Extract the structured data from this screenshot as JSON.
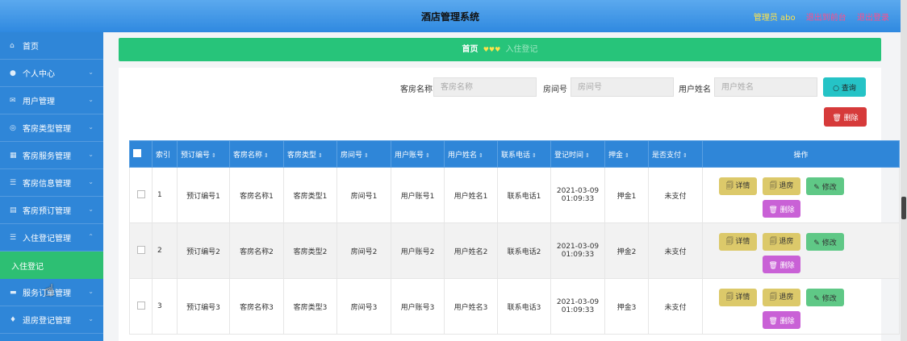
{
  "header": {
    "title": "酒店管理系统",
    "admin_label": "管理员 abo",
    "front_link": "退出到前台",
    "logout_link": "退出登录"
  },
  "sidebar": {
    "items": [
      {
        "label": "首页",
        "icon": "home-icon"
      },
      {
        "label": "个人中心",
        "icon": "user-icon"
      },
      {
        "label": "用户管理",
        "icon": "mail-icon"
      },
      {
        "label": "客房类型管理",
        "icon": "circle-icon"
      },
      {
        "label": "客房服务管理",
        "icon": "grid-icon"
      },
      {
        "label": "客房信息管理",
        "icon": "list-icon"
      },
      {
        "label": "客房预订管理",
        "icon": "calendar-icon"
      },
      {
        "label": "入住登记管理",
        "icon": "list-icon"
      },
      {
        "label": "入住登记",
        "icon": ""
      },
      {
        "label": "服务订单管理",
        "icon": "card-icon"
      },
      {
        "label": "退房登记管理",
        "icon": "pin-icon"
      }
    ]
  },
  "breadcrumb": {
    "home": "首页",
    "separator": "♥♥♥",
    "current": "入住登记"
  },
  "search": {
    "room_name_label": "客房名称",
    "room_name_placeholder": "客房名称",
    "room_no_label": "房间号",
    "room_no_placeholder": "房间号",
    "user_name_label": "用户姓名",
    "user_name_placeholder": "用户姓名",
    "search_button": "○ 查询",
    "delete_button": "🗑 删除"
  },
  "table": {
    "columns": [
      "索引",
      "预订编号",
      "客房名称",
      "客房类型",
      "房间号",
      "用户账号",
      "用户姓名",
      "联系电话",
      "登记时间",
      "押金",
      "是否支付",
      "操作"
    ],
    "sort_icon": "⇕",
    "rows": [
      {
        "index": "1",
        "booking": "预订编号1",
        "room_name": "客房名称1",
        "room_type": "客房类型1",
        "room_no": "房间号1",
        "account": "用户账号1",
        "user": "用户姓名1",
        "phone": "联系电话1",
        "date": "2021-03-09",
        "time": "01:09:33",
        "deposit": "押金1",
        "paid": "未支付"
      },
      {
        "index": "2",
        "booking": "预订编号2",
        "room_name": "客房名称2",
        "room_type": "客房类型2",
        "room_no": "房间号2",
        "account": "用户账号2",
        "user": "用户姓名2",
        "phone": "联系电话2",
        "date": "2021-03-09",
        "time": "01:09:33",
        "deposit": "押金2",
        "paid": "未支付"
      },
      {
        "index": "3",
        "booking": "预订编号3",
        "room_name": "客房名称3",
        "room_type": "客房类型3",
        "room_no": "房间号3",
        "account": "用户账号3",
        "user": "用户姓名3",
        "phone": "联系电话3",
        "date": "2021-03-09",
        "time": "01:09:33",
        "deposit": "押金3",
        "paid": "未支付"
      }
    ],
    "actions": {
      "detail": "🗐 详情",
      "checkout": "🗐 退房",
      "edit": "✎ 修改",
      "delete": "🗑 删除"
    }
  },
  "colors": {
    "header_blue": "#2f89e0",
    "sidebar_blue": "#2f86d8",
    "accent_green": "#27c47a",
    "search_teal": "#25c3c6",
    "danger_red": "#d63a3a",
    "detail_yellow": "#dcc96a",
    "edit_green": "#5fc886",
    "delete_purple": "#c961d6"
  }
}
